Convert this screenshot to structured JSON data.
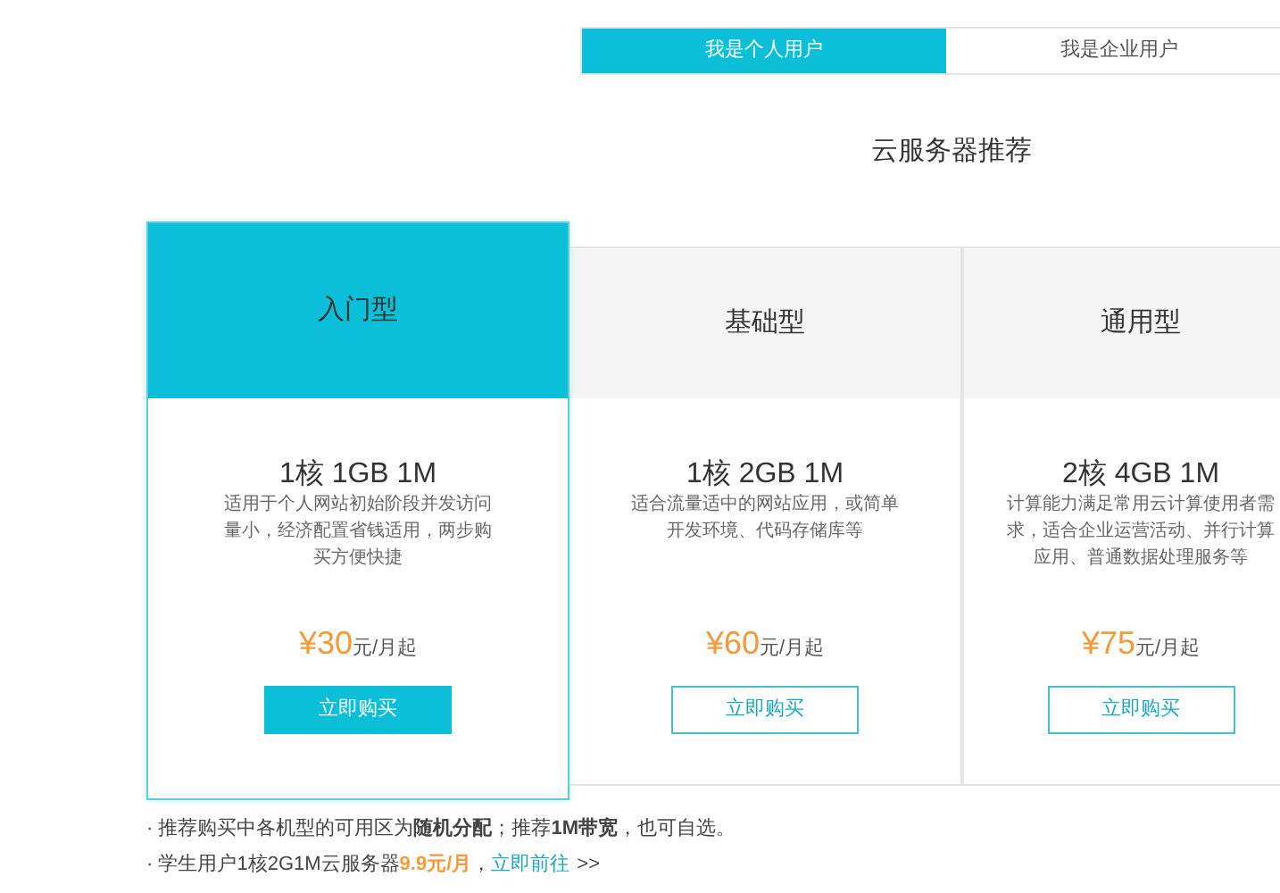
{
  "tabs": [
    {
      "label": "我是个人用户",
      "selected": true
    },
    {
      "label": "我是企业用户",
      "selected": false
    }
  ],
  "heading": "云服务器推荐",
  "plans": [
    {
      "name": "入门型",
      "spec": "1核 1GB 1M",
      "description": "适用于个人网站初始阶段并发访问量小，经济配置省钱适用，两步购买方便快捷",
      "price": "¥30",
      "unit": "元/月起",
      "button": "立即购买",
      "selected": true
    },
    {
      "name": "基础型",
      "spec": "1核 2GB 1M",
      "description": "适合流量适中的网站应用，或简单开发环境、代码存储库等",
      "price": "¥60",
      "unit": "元/月起",
      "button": "立即购买",
      "selected": false
    },
    {
      "name": "通用型",
      "spec": "2核 4GB 1M",
      "description": "计算能力满足常用云计算使用者需求，适合企业运营活动、并行计算应用、普通数据处理服务等",
      "price": "¥75",
      "unit": "元/月起",
      "button": "立即购买",
      "selected": false
    }
  ],
  "notes": [
    {
      "text": "· 推荐购买中各机型的可用区为**随机分配**；推荐**1M带宽**，也可自选。"
    },
    {
      "text": "· 学生用户1核2G1M云服务器",
      "price": "9.9元/月",
      "separator": "，",
      "link": "立即前往",
      "arrow": ">>"
    }
  ]
}
